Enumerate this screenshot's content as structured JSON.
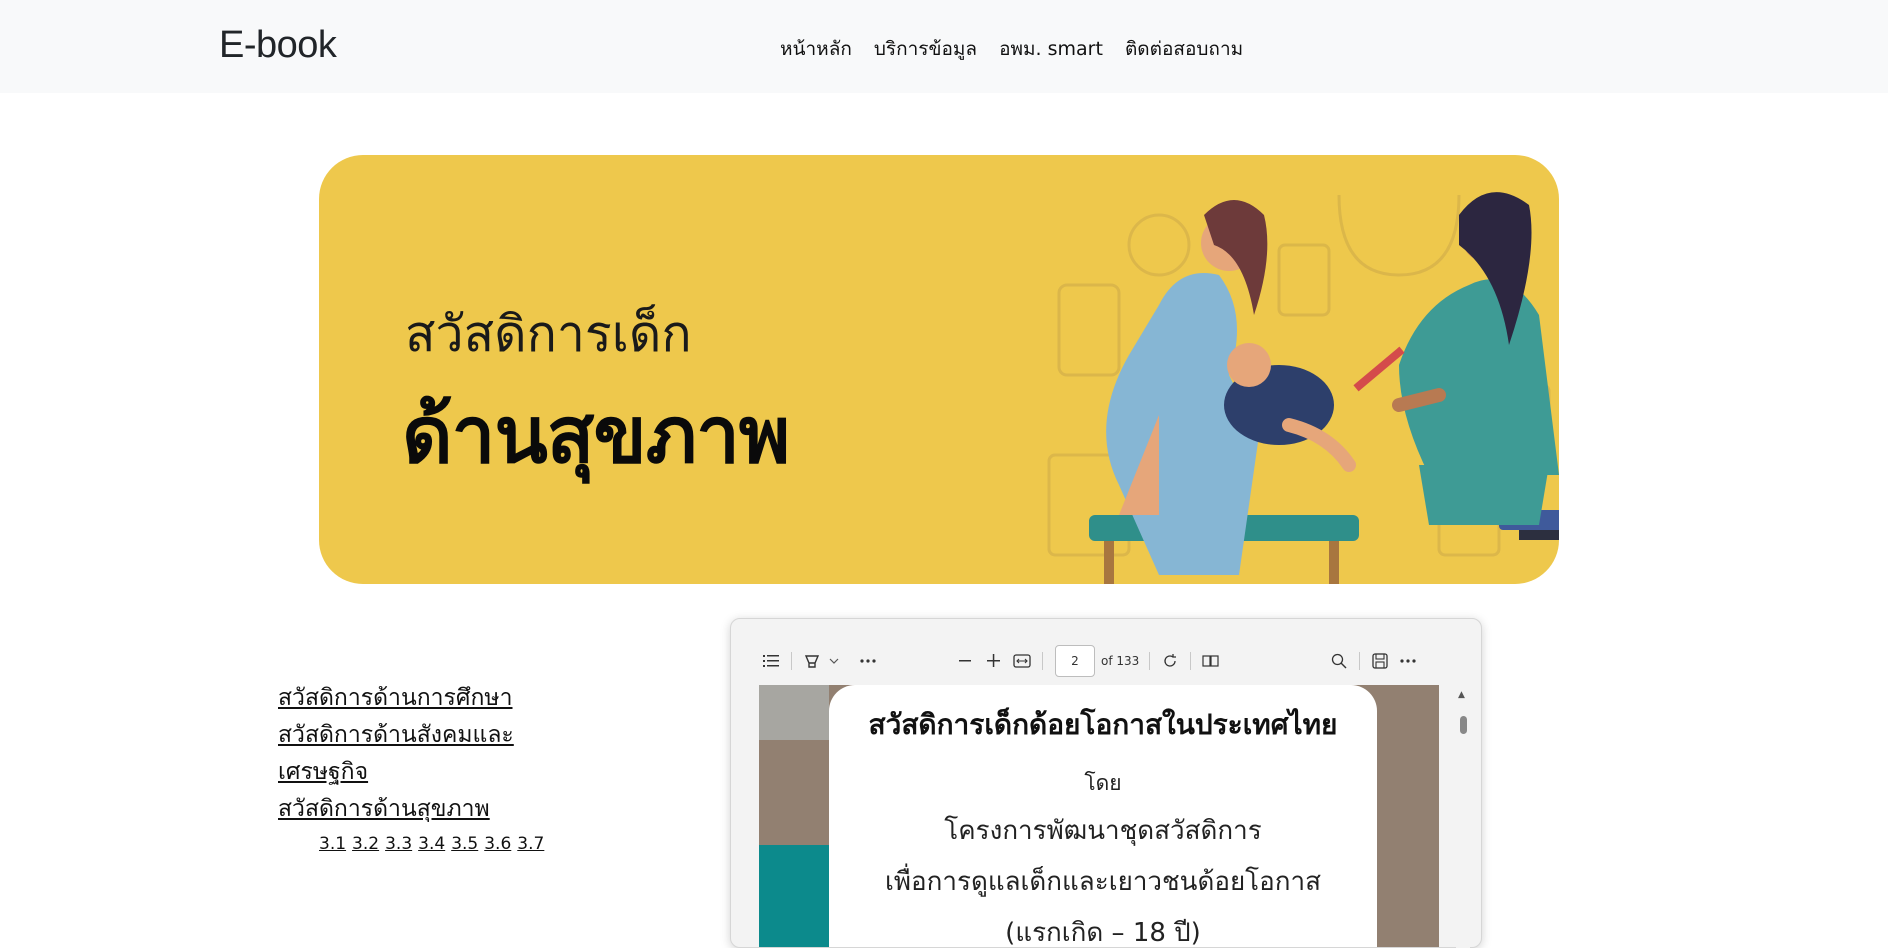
{
  "navbar": {
    "brand": "E-book",
    "links": [
      "หน้าหลัก",
      "บริการข้อมูล",
      "อพม. smart",
      "ติดต่อสอบถาม"
    ]
  },
  "banner": {
    "title_small": "สวัสดิการเด็ก",
    "title_big": "ด้านสุขภาพ"
  },
  "side_links": {
    "items": [
      "สวัสดิการด้านการศึกษา",
      "สวัสดิการด้านสังคมและเศรษฐกิจ",
      "สวัสดิการด้านสุขภาพ"
    ],
    "subs": [
      "3.1",
      "3.2",
      "3.3",
      "3.4",
      "3.5",
      "3.6",
      "3.7"
    ]
  },
  "pdf_viewer": {
    "page_current": "2",
    "page_total_label": "of 133",
    "doc": {
      "heading": "สวัสดิการเด็กด้อยโอกาสในประเทศไทย",
      "by": "โดย",
      "line1": "โครงการพัฒนาชุดสวัสดิการ",
      "line2": "เพื่อการดูแลเด็กและเยาวชนด้อยโอกาส",
      "line3": "(แรกเกิด – 18 ปี)"
    }
  },
  "colors": {
    "navbar_bg": "#f8f9fa",
    "banner_bg": "#eec84c",
    "doc_bg": "#928071",
    "teal": "#0c8a8c"
  }
}
